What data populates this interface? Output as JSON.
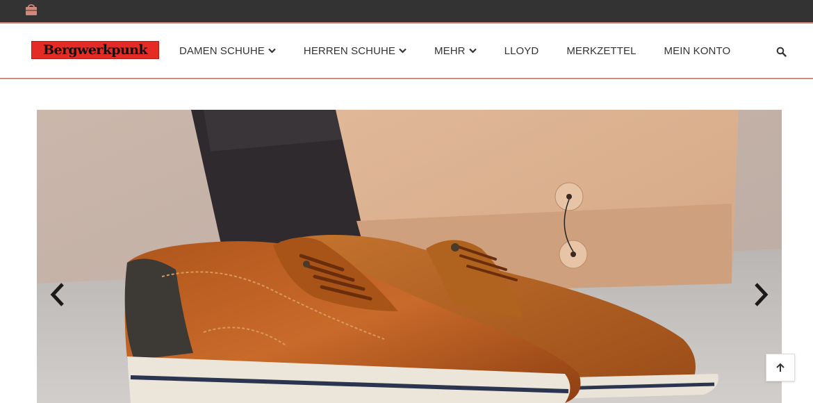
{
  "header": {
    "cart_icon": "shopping-bag-icon",
    "accent_color": "#d2887a",
    "topbar_color": "#333333"
  },
  "logo": {
    "text": "Bergwerkpunk",
    "background": "#e42b26"
  },
  "nav": {
    "items": [
      {
        "label": "DAMEN SCHUHE",
        "has_dropdown": true
      },
      {
        "label": "HERREN SCHUHE",
        "has_dropdown": true
      },
      {
        "label": "MEHR",
        "has_dropdown": true
      },
      {
        "label": "LLOYD",
        "has_dropdown": false
      },
      {
        "label": "MERKZETTEL",
        "has_dropdown": false
      },
      {
        "label": "MEIN KONTO",
        "has_dropdown": false
      }
    ],
    "search_icon": "search-icon"
  },
  "slider": {
    "prev_icon": "chevron-left-icon",
    "next_icon": "chevron-right-icon",
    "image_description_icon": "brown-leather-shoes-photo"
  },
  "back_to_top_icon": "arrow-up-icon"
}
